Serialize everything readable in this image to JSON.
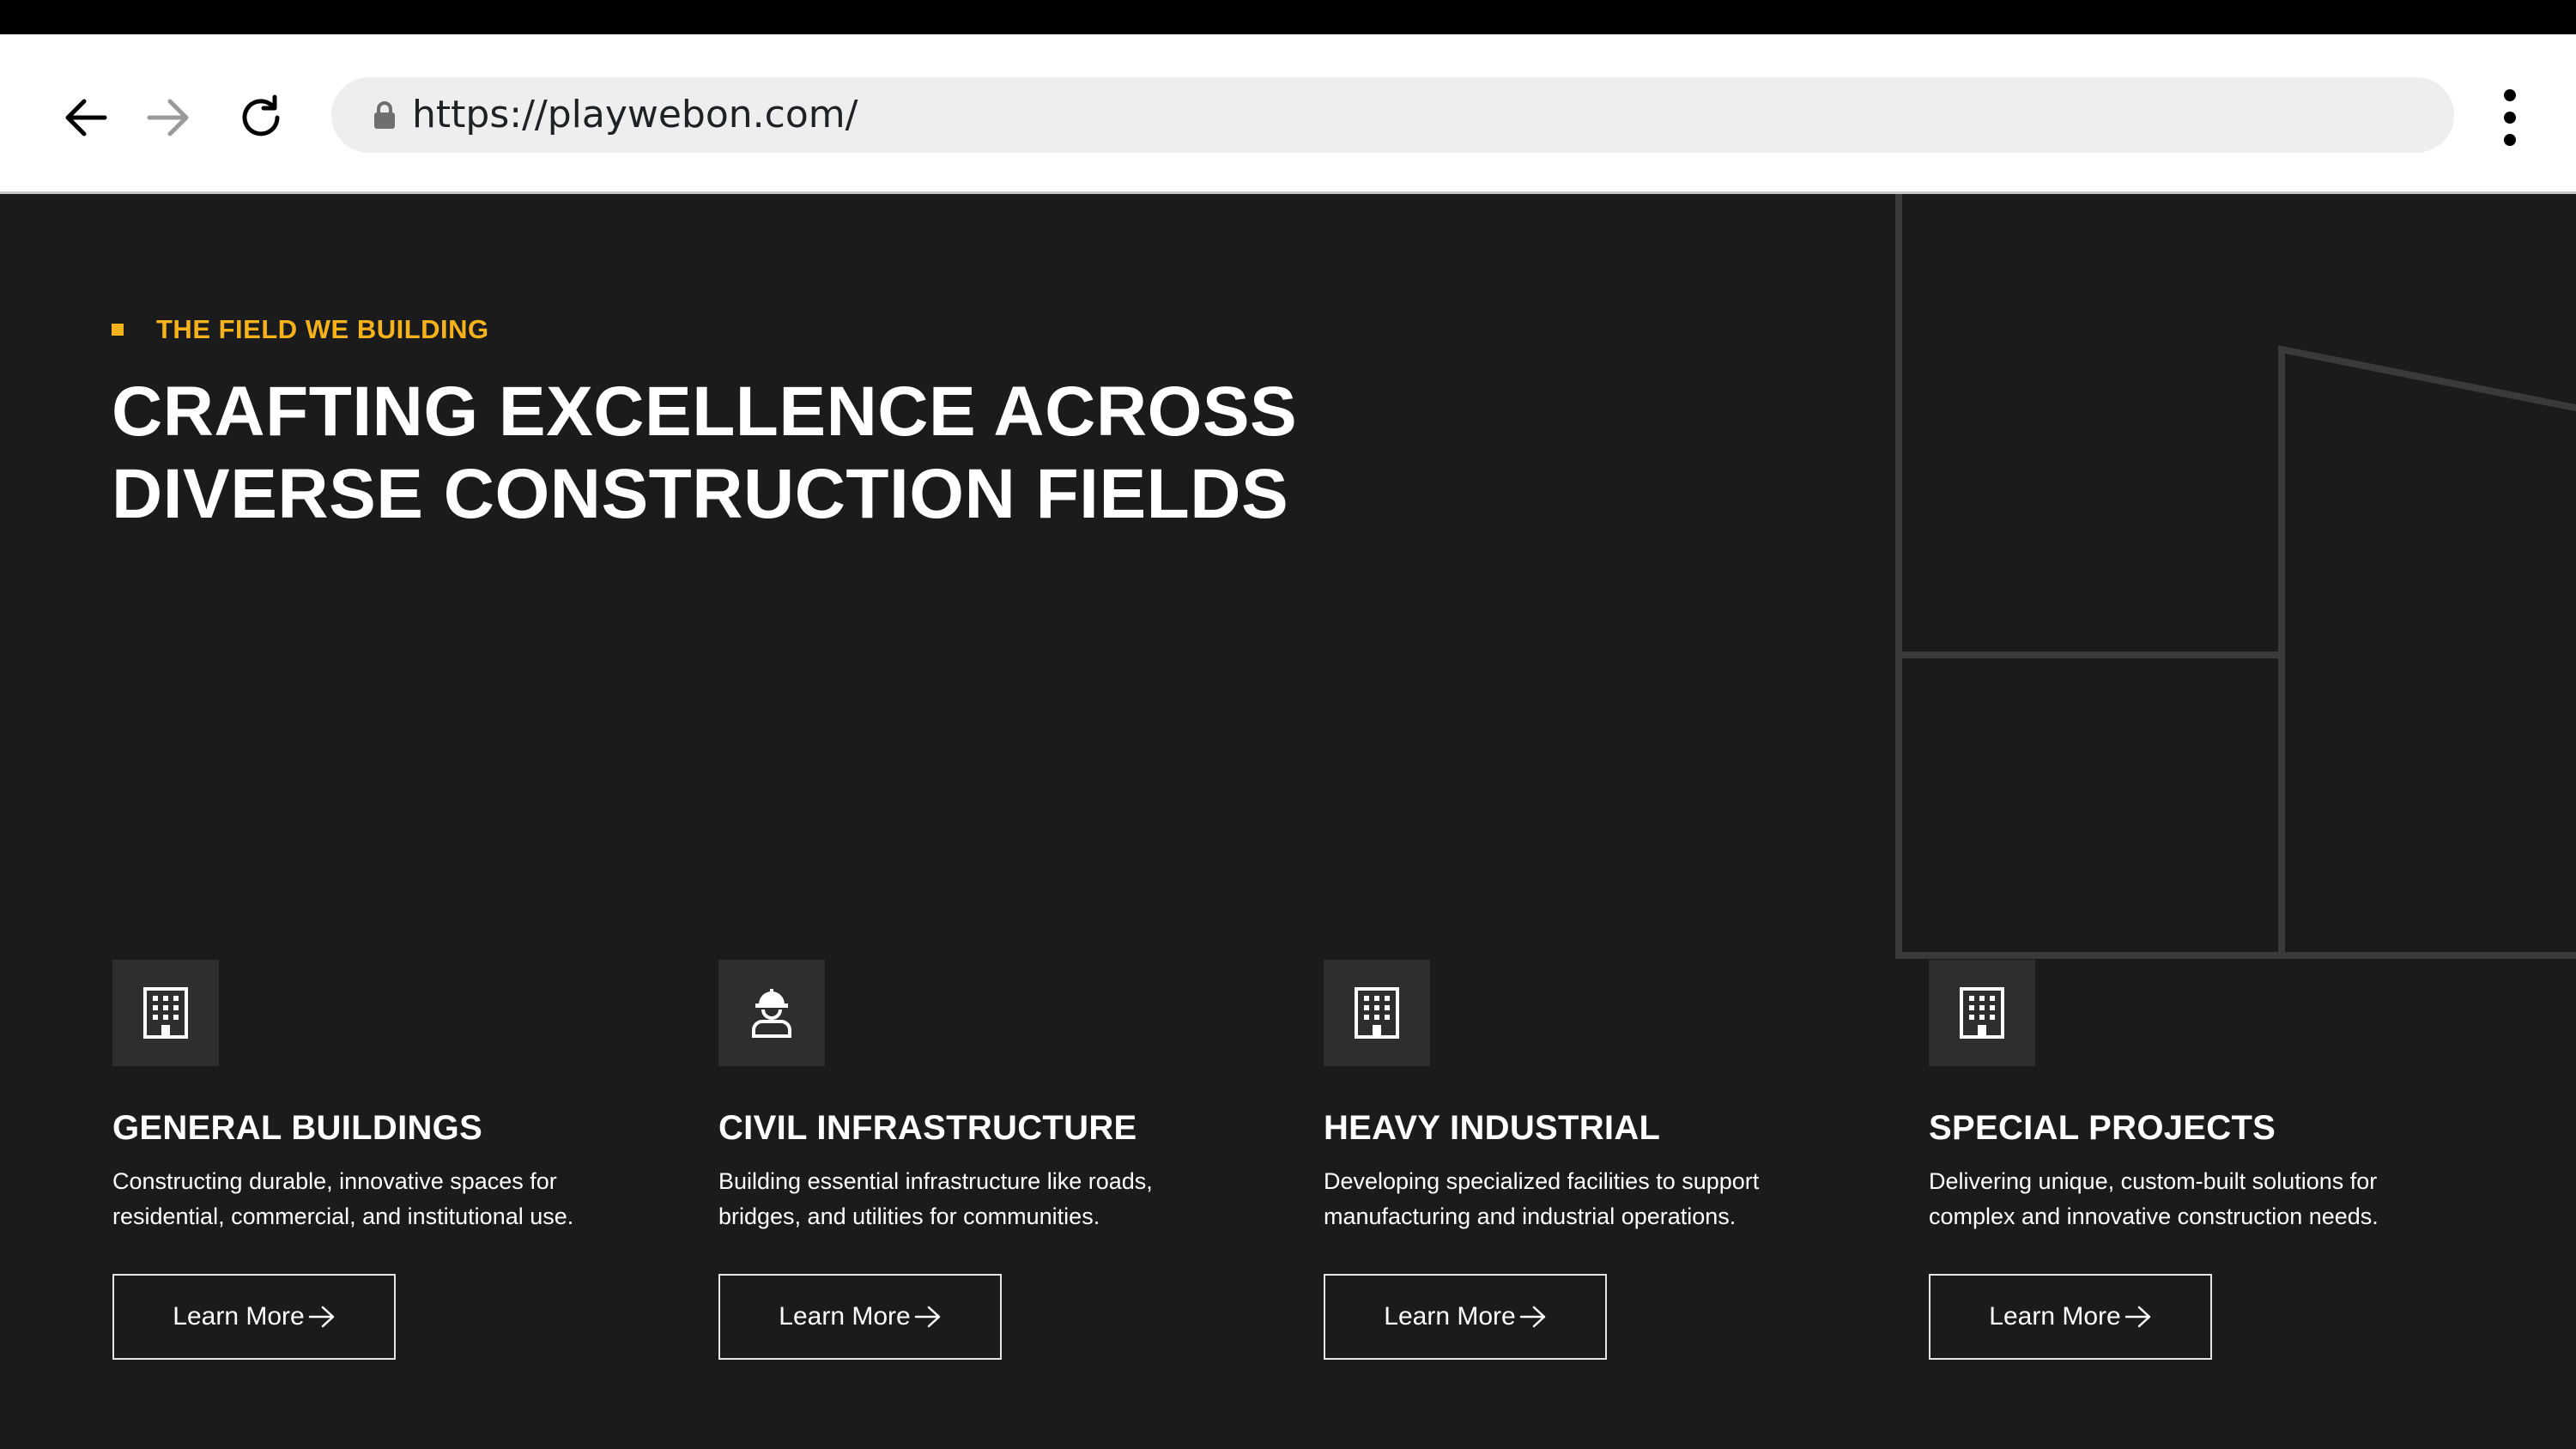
{
  "browser": {
    "url": "https://playwebon.com/",
    "back_icon": "arrow-left-icon",
    "forward_icon": "arrow-right-icon",
    "reload_icon": "reload-icon",
    "lock_icon": "lock-icon",
    "menu_icon": "more-vertical-icon"
  },
  "section": {
    "eyebrow": "THE FIELD WE BUILDING",
    "headline_line1": "CRAFTING EXCELLENCE ACROSS",
    "headline_line2": "DIVERSE CONSTRUCTION FIELDS"
  },
  "cards": [
    {
      "icon": "building-icon",
      "title": "GENERAL BUILDINGS",
      "desc_line1": "Constructing durable, innovative spaces for",
      "desc_line2": "residential, commercial, and institutional use.",
      "button": "Learn More"
    },
    {
      "icon": "worker-icon",
      "title": "CIVIL INFRASTRUCTURE",
      "desc_line1": "Building essential infrastructure like roads,",
      "desc_line2": "bridges, and utilities for communities.",
      "button": "Learn More"
    },
    {
      "icon": "building-icon",
      "title": "HEAVY INDUSTRIAL",
      "desc_line1": "Developing specialized facilities to support",
      "desc_line2": "manufacturing and industrial operations.",
      "button": "Learn More"
    },
    {
      "icon": "building-icon",
      "title": "SPECIAL PROJECTS",
      "desc_line1": "Delivering unique, custom-built solutions for",
      "desc_line2": "complex and innovative construction needs.",
      "button": "Learn More"
    }
  ],
  "colors": {
    "accent": "#f5b21b",
    "background": "#1b1b1b",
    "icon_box": "#2e2e2e",
    "text": "#ffffff"
  }
}
